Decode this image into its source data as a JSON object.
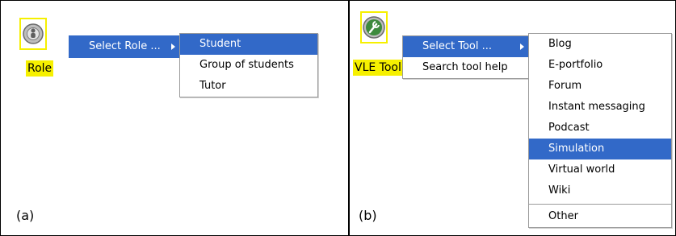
{
  "panel_a": {
    "icon_label": "Role",
    "submenu_label": "Select Role ...",
    "options": [
      "Student",
      "Group of students",
      "Tutor"
    ],
    "selected_option": "Student",
    "caption": "(a)"
  },
  "panel_b": {
    "icon_label": "VLE Tool",
    "menu_items": [
      "Select Tool ...",
      "Search tool help"
    ],
    "tools": [
      "Blog",
      "E-portfolio",
      "Forum",
      "Instant messaging",
      "Podcast",
      "Simulation",
      "Virtual world",
      "Wiki"
    ],
    "other_label": "Other",
    "selected_tool": "Simulation",
    "caption": "(b)"
  },
  "colors": {
    "highlight": "#3269c8",
    "icon_highlight": "#f6f000"
  }
}
